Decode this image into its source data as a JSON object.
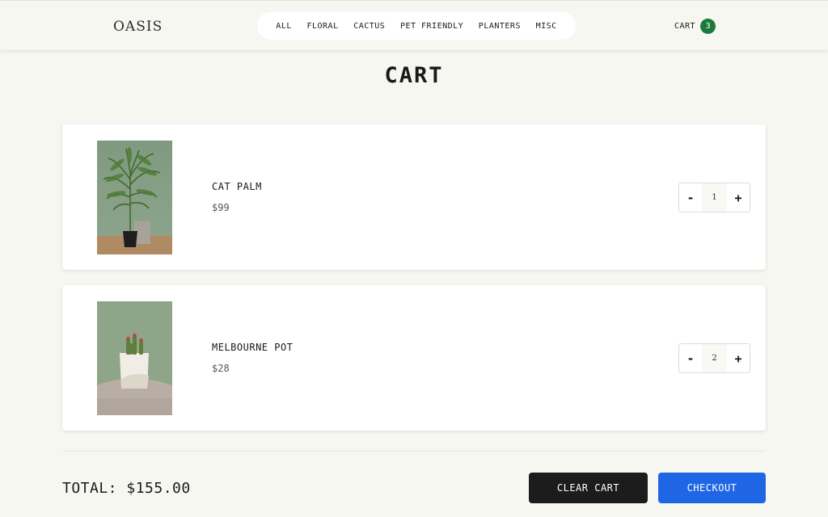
{
  "header": {
    "logo": "OASIS",
    "nav": [
      "ALL",
      "FLORAL",
      "CACTUS",
      "PET FRIENDLY",
      "PLANTERS",
      "MISC"
    ],
    "cart_label": "CART",
    "cart_count": "3"
  },
  "page_title": "CART",
  "items": [
    {
      "name": "CAT PALM",
      "price": "$99",
      "qty": "1",
      "qty_minus": "-",
      "qty_plus": "+"
    },
    {
      "name": "MELBOURNE POT",
      "price": "$28",
      "qty": "2",
      "qty_minus": "-",
      "qty_plus": "+"
    }
  ],
  "footer": {
    "total": "TOTAL: $155.00",
    "clear_label": "CLEAR CART",
    "checkout_label": "CHECKOUT"
  },
  "colors": {
    "background": "#f7f7f2",
    "cart_badge": "#1e7a3c",
    "clear_button": "#1c1c1c",
    "checkout_button": "#1f66e5"
  }
}
